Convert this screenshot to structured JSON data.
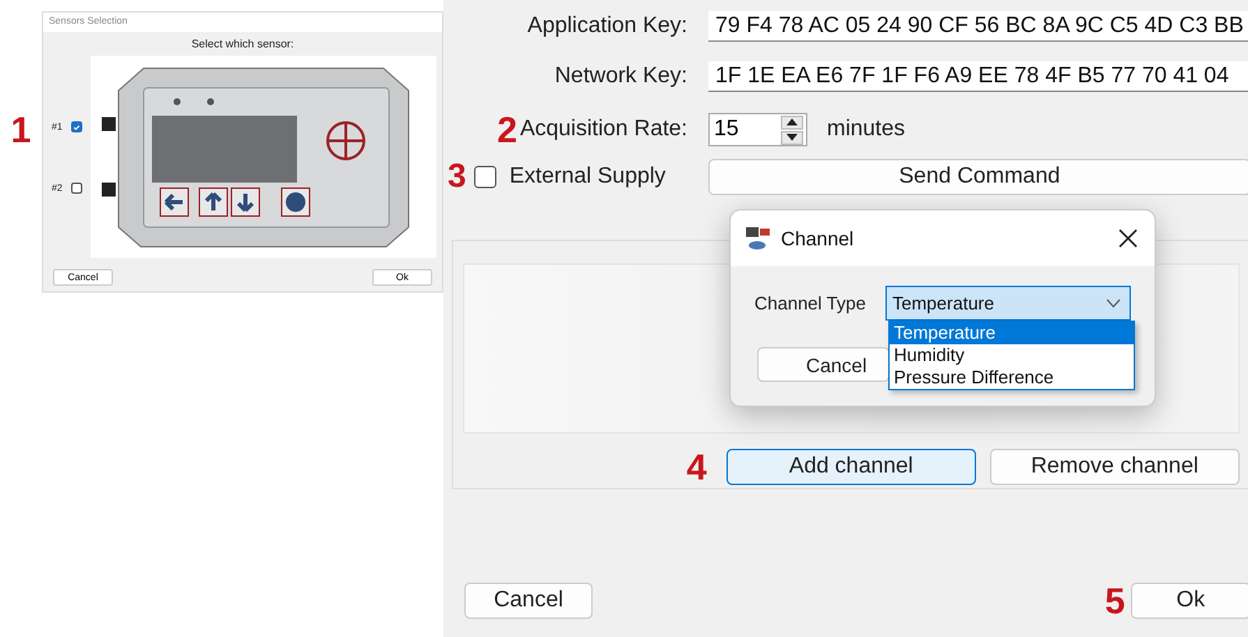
{
  "sensor_dialog": {
    "annotation": "1",
    "title": "Sensors Selection",
    "prompt": "Select which sensor:",
    "sensors": [
      {
        "label": "#1",
        "checked": true
      },
      {
        "label": "#2",
        "checked": false
      }
    ],
    "cancel": "Cancel",
    "ok": "Ok"
  },
  "settings": {
    "fields": [
      {
        "label": "Application Key:",
        "value": "79 F4 78 AC 05 24 90 CF 56 BC 8A 9C C5 4D C3 BB"
      },
      {
        "label": "Network Key:",
        "value": "1F 1E EA E6 7F 1F F6 A9 EE 78 4F B5 77 70 41 04"
      }
    ],
    "acquisition_rate": {
      "annotation": "2",
      "label": "Acquisition Rate:",
      "value": "15",
      "unit": "minutes"
    },
    "external_supply": {
      "annotation": "3",
      "label": "External Supply",
      "checked": false
    },
    "send_button": "Send Command",
    "channel_buttons": {
      "annotation": "4",
      "add": "Add channel",
      "remove": "Remove channel"
    },
    "footer": {
      "cancel": "Cancel",
      "annotation": "5",
      "ok": "Ok"
    }
  },
  "channel_dialog": {
    "title": "Channel",
    "field_label": "Channel Type",
    "value": "Temperature",
    "expanded": true,
    "options": [
      {
        "label": "Temperature",
        "selected": true
      },
      {
        "label": "Humidity",
        "selected": false
      },
      {
        "label": "Pressure Difference",
        "selected": false
      }
    ],
    "cancel": "Cancel"
  }
}
